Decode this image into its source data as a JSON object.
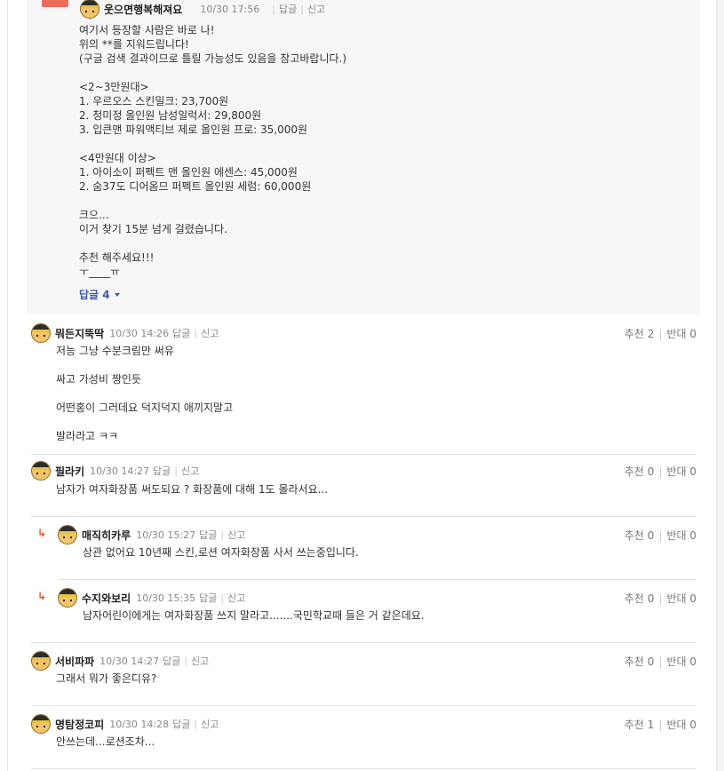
{
  "top": {
    "nick": "웃으면행복해져요",
    "time": "10/30 17:56",
    "reply": "답글",
    "report": "신고",
    "lines": [
      "여기서 등장할 사람은 바로 나!",
      "위의 **를 지워드립니다!",
      "(구글 검색 결과이므로 틀릴 가능성도 있음을 참고바랍니다.)",
      "",
      "<2~3만원대>",
      "1. 우르오스 스킨밀크: 23,700원",
      "2. 청미정 올인원 남성일럭서: 29,800원",
      "3. 입큰맨 파워액티브 제로 올인원 프로: 35,000원",
      "",
      "<4만원대 이상>",
      "1. 아이소이 퍼펙트 맨 올인원 에센스: 45,000원",
      "2. 숨37도 디어옴므 퍼펙트 올인원 세럼: 60,000원",
      "",
      "크으...",
      "이거 찾기 15분 넘게 걸렸습니다.",
      "",
      "추천 해주세요!!!",
      "ㅜ____ㅠ"
    ],
    "reply_toggle": "답글 4"
  },
  "comments": [
    {
      "nick": "뭐든지뚝딱",
      "time": "10/30 14:26",
      "reply": "답글",
      "report": "신고",
      "up": "추천 2",
      "down": "반대 0",
      "lines": [
        "저능 그냥 수분크림만 써유",
        "",
        "싸고 가성비 짱인듯",
        "",
        "어떤홍이 그러데요 덕지덕지 애끼지말고",
        "",
        "발라라고 ㅋㅋ"
      ]
    },
    {
      "nick": "필라키",
      "time": "10/30 14:27",
      "reply": "답글",
      "report": "신고",
      "up": "추천 0",
      "down": "반대 0",
      "lines": [
        "남자가 여자화장품 써도되요 ? 화장품에 대해 1도 몰라서요..."
      ]
    },
    {
      "nick": "매직히카루",
      "time": "10/30 15:27",
      "reply": "답글",
      "report": "신고",
      "up": "추천 0",
      "down": "반대 0",
      "lines": [
        "상관 없어요 10년째 스킨,로션 여자화장품 사서 쓰는중입니다."
      ]
    },
    {
      "nick": "수지와보리",
      "time": "10/30 15:35",
      "reply": "답글",
      "report": "신고",
      "up": "추천 0",
      "down": "반대 0",
      "lines": [
        "남자어린이에게는 여자화장품 쓰지 말라고.......국민학교때 들은 거 같은데요."
      ]
    },
    {
      "nick": "서비파파",
      "time": "10/30 14:27",
      "reply": "답글",
      "report": "신고",
      "up": "추천 0",
      "down": "반대 0",
      "lines": [
        "그래서 뭐가 좋은디유?"
      ]
    },
    {
      "nick": "명탐정코피",
      "time": "10/30 14:28",
      "reply": "답글",
      "report": "신고",
      "up": "추천 1",
      "down": "반대 0",
      "lines": [
        "안쓰는데...로션조차..."
      ]
    }
  ]
}
